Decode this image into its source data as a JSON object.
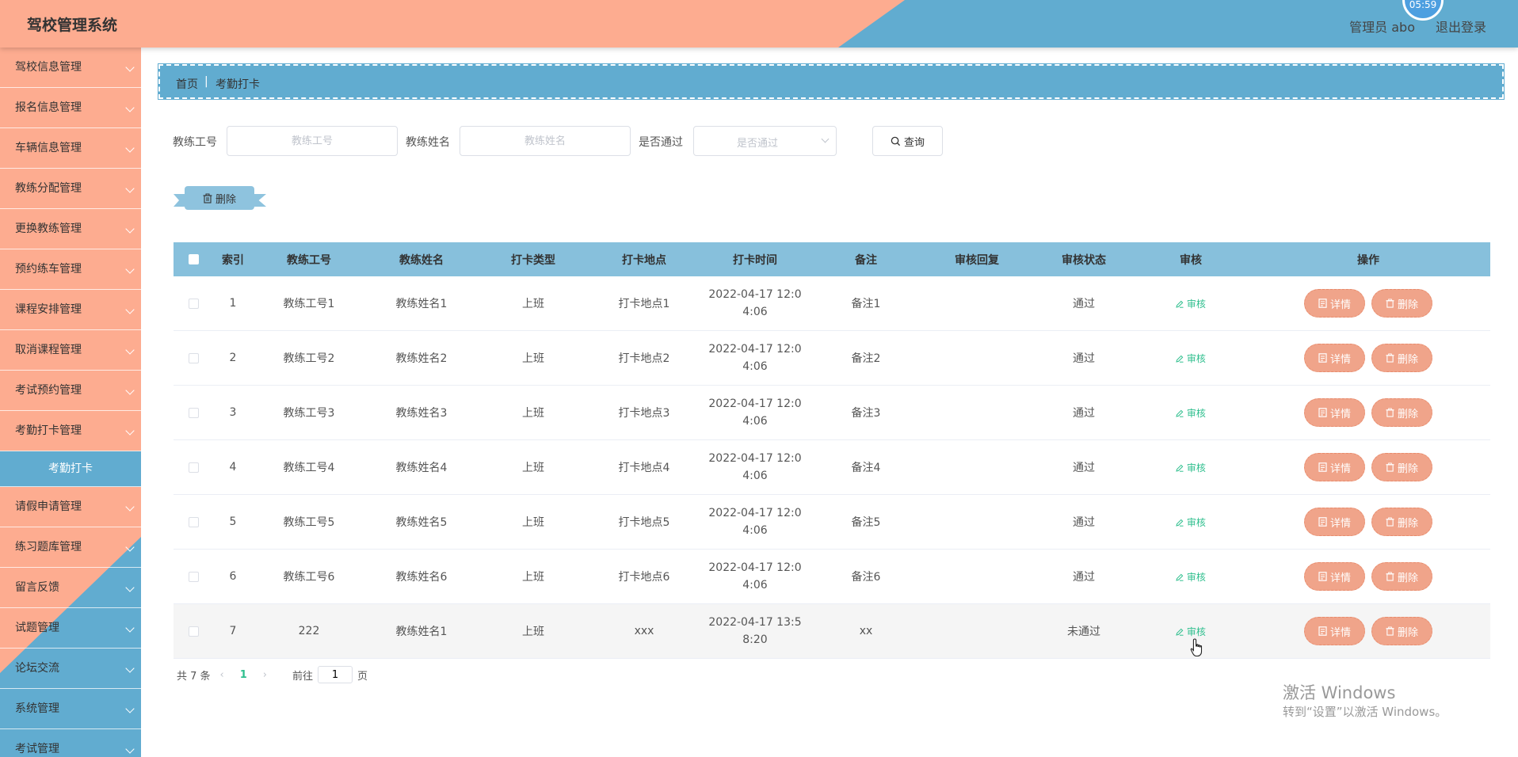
{
  "header": {
    "title": "驾校管理系统",
    "user": "管理员 abo",
    "logout": "退出登录",
    "clock": "05:59",
    "colors": {
      "salmon": "#fdac90",
      "blue": "#61acd0"
    }
  },
  "sidebar": {
    "items": [
      {
        "label": "驾校信息管理"
      },
      {
        "label": "报名信息管理"
      },
      {
        "label": "车辆信息管理"
      },
      {
        "label": "教练分配管理"
      },
      {
        "label": "更换教练管理"
      },
      {
        "label": "预约练车管理"
      },
      {
        "label": "课程安排管理"
      },
      {
        "label": "取消课程管理"
      },
      {
        "label": "考试预约管理"
      },
      {
        "label": "考勤打卡管理"
      },
      {
        "label": "考勤打卡"
      },
      {
        "label": "请假申请管理"
      },
      {
        "label": "练习题库管理"
      },
      {
        "label": "留言反馈"
      },
      {
        "label": "试题管理"
      },
      {
        "label": "论坛交流"
      },
      {
        "label": "系统管理"
      },
      {
        "label": "考试管理"
      }
    ]
  },
  "breadcrumb": {
    "home": "首页",
    "separator": "|",
    "current": "考勤打卡"
  },
  "search": {
    "coach_id_label": "教练工号",
    "coach_id_placeholder": "教练工号",
    "coach_name_label": "教练姓名",
    "coach_name_placeholder": "教练姓名",
    "passed_label": "是否通过",
    "passed_placeholder": "是否通过",
    "query_label": "查询"
  },
  "toolbar": {
    "delete_label": "删除"
  },
  "table": {
    "headers": [
      "索引",
      "教练工号",
      "教练姓名",
      "打卡类型",
      "打卡地点",
      "打卡时间",
      "备注",
      "审核回复",
      "审核状态",
      "审核",
      "操作"
    ],
    "audit_label": "审核",
    "detail_label": "详情",
    "delete_label": "删除",
    "rows": [
      {
        "index": "1",
        "coach_id": "教练工号1",
        "coach_name": "教练姓名1",
        "type": "上班",
        "location": "打卡地点1",
        "time_line1": "2022-04-17 12:0",
        "time_line2": "4:06",
        "remark": "备注1",
        "reply": "",
        "status": "通过"
      },
      {
        "index": "2",
        "coach_id": "教练工号2",
        "coach_name": "教练姓名2",
        "type": "上班",
        "location": "打卡地点2",
        "time_line1": "2022-04-17 12:0",
        "time_line2": "4:06",
        "remark": "备注2",
        "reply": "",
        "status": "通过"
      },
      {
        "index": "3",
        "coach_id": "教练工号3",
        "coach_name": "教练姓名3",
        "type": "上班",
        "location": "打卡地点3",
        "time_line1": "2022-04-17 12:0",
        "time_line2": "4:06",
        "remark": "备注3",
        "reply": "",
        "status": "通过"
      },
      {
        "index": "4",
        "coach_id": "教练工号4",
        "coach_name": "教练姓名4",
        "type": "上班",
        "location": "打卡地点4",
        "time_line1": "2022-04-17 12:0",
        "time_line2": "4:06",
        "remark": "备注4",
        "reply": "",
        "status": "通过"
      },
      {
        "index": "5",
        "coach_id": "教练工号5",
        "coach_name": "教练姓名5",
        "type": "上班",
        "location": "打卡地点5",
        "time_line1": "2022-04-17 12:0",
        "time_line2": "4:06",
        "remark": "备注5",
        "reply": "",
        "status": "通过"
      },
      {
        "index": "6",
        "coach_id": "教练工号6",
        "coach_name": "教练姓名6",
        "type": "上班",
        "location": "打卡地点6",
        "time_line1": "2022-04-17 12:0",
        "time_line2": "4:06",
        "remark": "备注6",
        "reply": "",
        "status": "通过"
      },
      {
        "index": "7",
        "coach_id": "222",
        "coach_name": "教练姓名1",
        "type": "上班",
        "location": "xxx",
        "time_line1": "2022-04-17 13:5",
        "time_line2": "8:20",
        "remark": "xx",
        "reply": "",
        "status": "未通过"
      }
    ]
  },
  "pagination": {
    "total": "共 7 条",
    "current_page": "1",
    "goto_label": "前往",
    "goto_value": "1",
    "page_suffix": "页"
  },
  "watermark": {
    "line1": "激活 Windows",
    "line2": "转到“设置”以激活 Windows。"
  }
}
